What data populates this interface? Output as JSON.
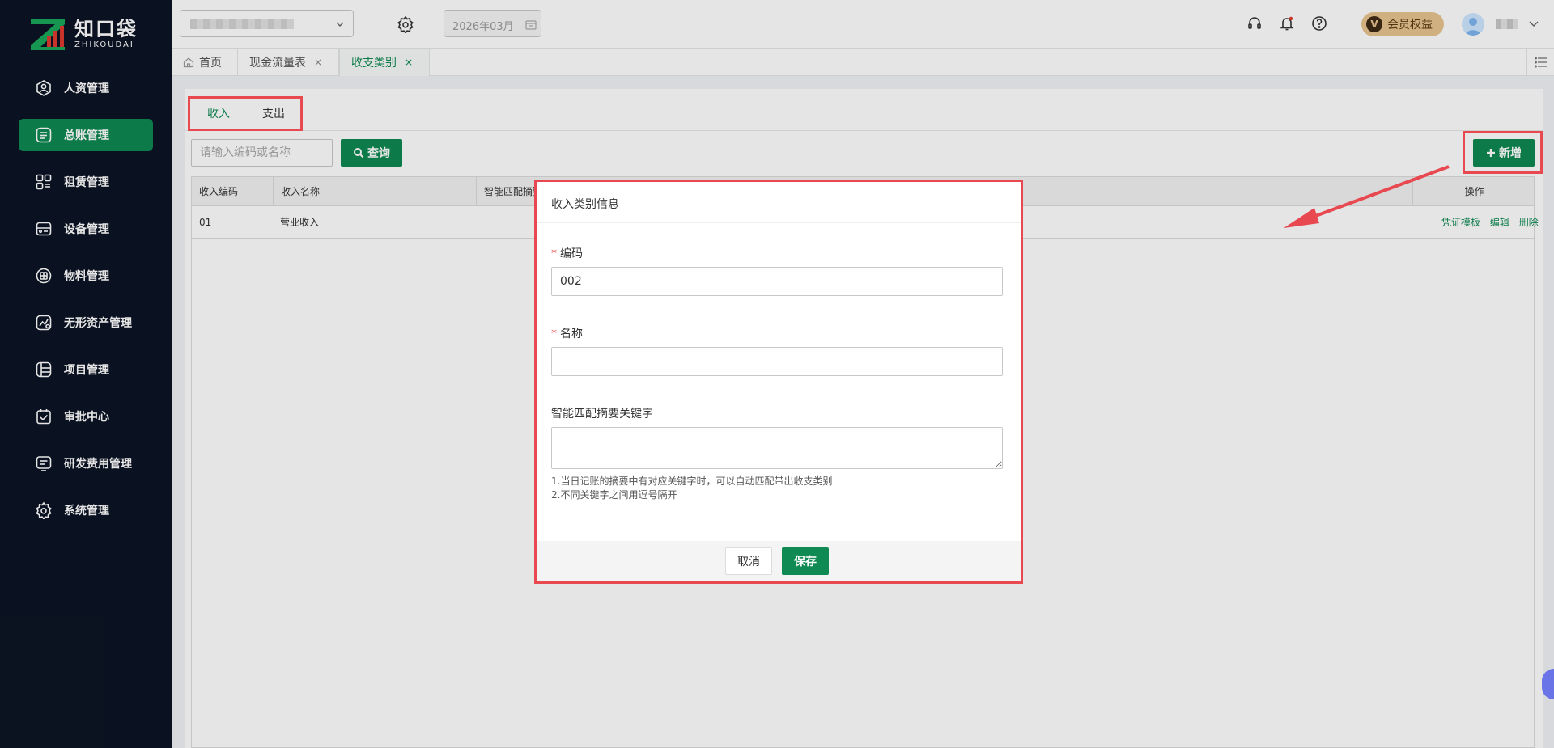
{
  "brand": {
    "name_cn": "知口袋",
    "name_en": "ZHIKOUDAI"
  },
  "sidebar": {
    "items": [
      {
        "label": "人资管理",
        "icon": "person-icon"
      },
      {
        "label": "总账管理",
        "icon": "ledger-icon",
        "active": true
      },
      {
        "label": "租赁管理",
        "icon": "lease-icon"
      },
      {
        "label": "设备管理",
        "icon": "device-icon"
      },
      {
        "label": "物料管理",
        "icon": "material-icon"
      },
      {
        "label": "无形资产管理",
        "icon": "intangible-asset-icon"
      },
      {
        "label": "项目管理",
        "icon": "project-icon"
      },
      {
        "label": "审批中心",
        "icon": "approval-icon"
      },
      {
        "label": "研发费用管理",
        "icon": "rnd-expense-icon"
      },
      {
        "label": "系统管理",
        "icon": "settings-icon"
      }
    ]
  },
  "topbar": {
    "date_value": "2026年03月",
    "vip_badge": "V",
    "vip_label": "会员权益"
  },
  "tabs": [
    {
      "label": "首页"
    },
    {
      "label": "现金流量表",
      "close": "×"
    },
    {
      "label": "收支类别",
      "close": "×",
      "active": true
    }
  ],
  "subtabs": {
    "income": "收入",
    "expense": "支出",
    "active": "income"
  },
  "toolbar": {
    "search_placeholder": "请输入编码或名称",
    "query_label": "查询",
    "add_label": "新增"
  },
  "table": {
    "headers": [
      "收入编码",
      "收入名称",
      "智能匹配摘要关键字",
      "操作"
    ],
    "rows": [
      {
        "code": "01",
        "name": "营业收入",
        "actions": [
          "凭证模板",
          "编辑",
          "删除"
        ]
      }
    ]
  },
  "modal": {
    "title": "收入类别信息",
    "code_label": "编码",
    "code_value": "002",
    "name_label": "名称",
    "name_value": "",
    "keywords_label": "智能匹配摘要关键字",
    "hint_1": "1.当日记账的摘要中有对应关键字时，可以自动匹配带出收支类别",
    "hint_2": "2.不同关键字之间用逗号隔开",
    "required_mark": "*",
    "cancel_label": "取消",
    "save_label": "保存"
  },
  "colors": {
    "accent": "#0e8a52",
    "sidebar_bg": "#0c1424",
    "highlight": "#e8484f",
    "vip": "#e8c58f"
  }
}
